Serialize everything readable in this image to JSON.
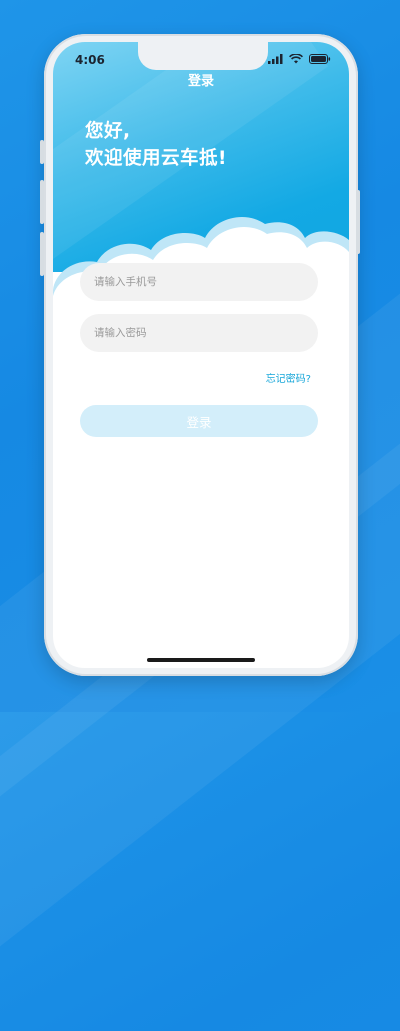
{
  "status_bar": {
    "time": "4:06"
  },
  "nav": {
    "title": "登录"
  },
  "greeting": {
    "line1": "您好,",
    "line2": "欢迎使用云车抵!"
  },
  "form": {
    "phone_placeholder": "请输入手机号",
    "password_placeholder": "请输入密码",
    "forgot_label": "忘记密码?",
    "login_label": "登录"
  },
  "colors": {
    "accent": "#13a9e4",
    "link": "#16a6d9",
    "button_disabled": "#d3eefa",
    "input_bg": "#f2f2f2"
  },
  "icons": [
    "signal-icon",
    "wifi-icon",
    "battery-icon"
  ]
}
